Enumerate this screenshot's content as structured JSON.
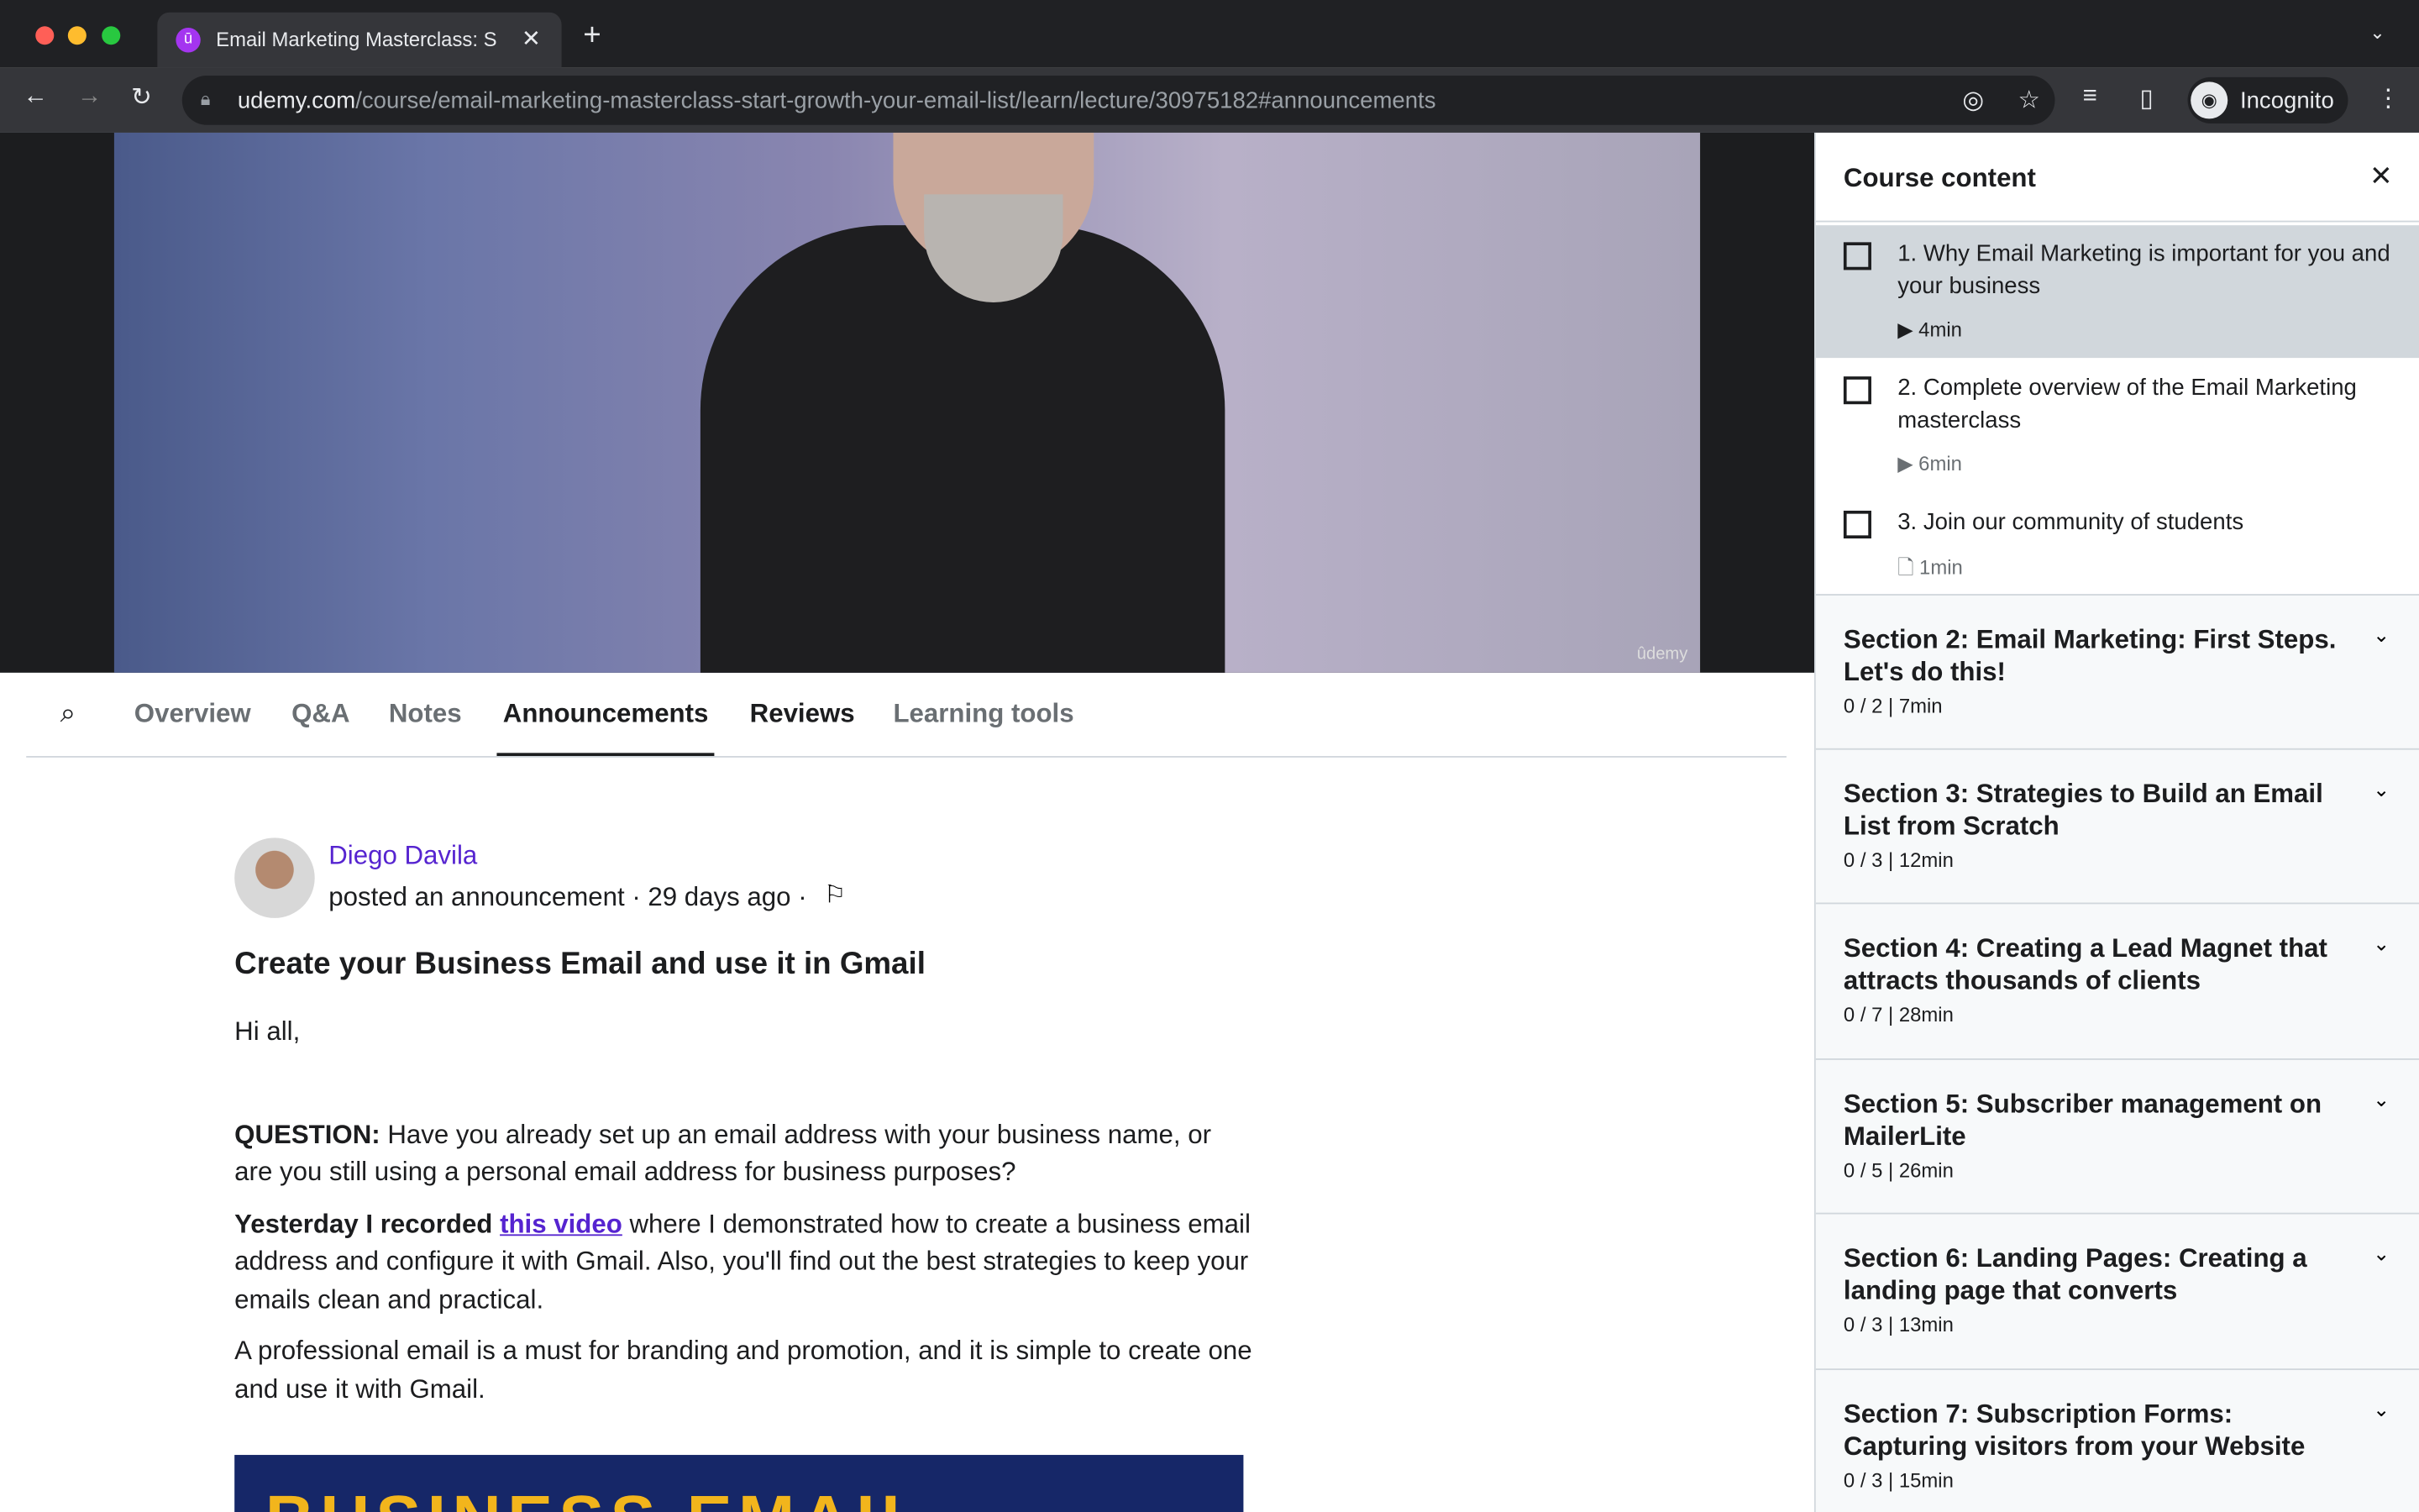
{
  "browser": {
    "tab_title": "Email Marketing Masterclass: S",
    "url_host": "udemy.com",
    "url_path": "/course/email-marketing-masterclass-start-growth-your-email-list/learn/lecture/30975182#announcements",
    "profile": "Incognito"
  },
  "video": {
    "watermark": "ûdemy"
  },
  "tabs": [
    "Overview",
    "Q&A",
    "Notes",
    "Announcements",
    "Reviews",
    "Learning tools"
  ],
  "announcement": {
    "author": "Diego Davila",
    "meta": "posted an announcement · 29 days ago ·",
    "title": "Create your Business Email and use it in Gmail",
    "greeting": "Hi all,",
    "q_label": "QUESTION:",
    "q_text": " Have you already set up an email address with your business name, or are you still using a personal email address for business purposes?",
    "y_bold": "Yesterday I recorded ",
    "y_link": "this video",
    "y_text": " where I demonstrated how to create a business email address and configure it with Gmail. Also, you'll find out the best strategies to keep your emails clean and practical.",
    "p3": "A professional email is a must for branding and promotion, and it is simple to create one and use it with Gmail.",
    "banner": "BUSINESS EMAIL"
  },
  "sidebar": {
    "title": "Course content",
    "lectures": [
      {
        "title": "1. Why Email Marketing is important for you and your business",
        "duration": "4min"
      },
      {
        "title": "2. Complete overview of the Email Marketing masterclass",
        "duration": "6min"
      },
      {
        "title": "3. Join our community of students",
        "duration": "1min"
      }
    ],
    "sections": [
      {
        "title": "Section 2: Email Marketing: First Steps. Let's do this!",
        "meta": "0 / 2 | 7min"
      },
      {
        "title": "Section 3: Strategies to Build an Email List from Scratch",
        "meta": "0 / 3 | 12min"
      },
      {
        "title": "Section 4: Creating a Lead Magnet that attracts thousands of clients",
        "meta": "0 / 7 | 28min"
      },
      {
        "title": "Section 5: Subscriber management on MailerLite",
        "meta": "0 / 5 | 26min"
      },
      {
        "title": "Section 6: Landing Pages: Creating a landing page that converts",
        "meta": "0 / 3 | 13min"
      },
      {
        "title": "Section 7: Subscription Forms: Capturing visitors from your Website",
        "meta": "0 / 3 | 15min"
      }
    ]
  }
}
